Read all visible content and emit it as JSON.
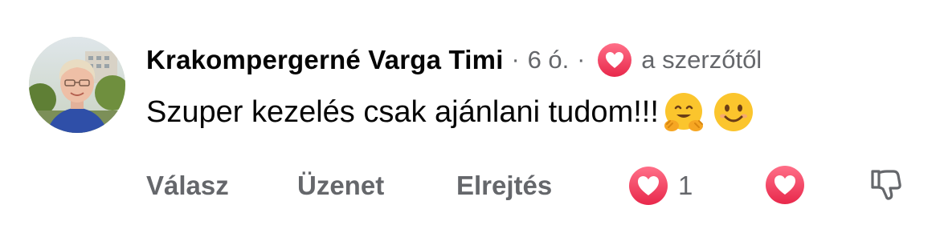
{
  "comment": {
    "author": "Krakompergerné Varga Timi",
    "separator": "·",
    "time": "6 ó.",
    "author_badge_icon": "heart-icon",
    "by_author_label": "a szerzőtől",
    "text": "Szuper kezelés csak ajánlani tudom!!!",
    "emojis": [
      "hugging-face-emoji",
      "smiling-face-emoji"
    ]
  },
  "actions": {
    "reply_label": "Válasz",
    "message_label": "Üzenet",
    "hide_label": "Elrejtés",
    "reaction_icon": "heart-icon",
    "reaction_count": "1",
    "react_icon": "heart-icon",
    "dislike_icon": "thumbs-down-icon"
  },
  "colors": {
    "heart_gradient_top": "#ff6f88",
    "heart_gradient_bottom": "#e8284b",
    "secondary_text": "#65676b",
    "primary_text": "#050505"
  }
}
